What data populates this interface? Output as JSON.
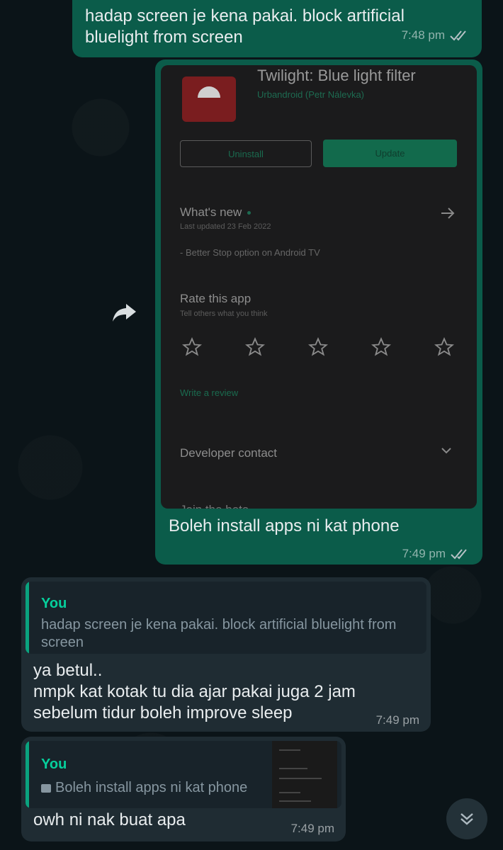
{
  "messages": [
    {
      "id": "m1",
      "text": "hadap screen je kena pakai. block artificial bluelight from screen",
      "time": "7:48 pm",
      "status": "read"
    },
    {
      "id": "m2",
      "caption": "Boleh install apps ni kat phone",
      "time": "7:49 pm",
      "status": "read",
      "screenshot": {
        "app_title": "Twilight: Blue light filter",
        "developer": "Urbandroid (Petr Nálevka)",
        "uninstall_label": "Uninstall",
        "update_label": "Update",
        "whats_new_title": "What's new",
        "last_updated": "Last updated 23 Feb 2022",
        "update_note": "- Better Stop option on Android TV",
        "rate_title": "Rate this app",
        "rate_sub": "Tell others what you think",
        "write_review": "Write a review",
        "developer_contact": "Developer contact",
        "cut_text": "Join the beta"
      }
    },
    {
      "id": "m3",
      "quote_author": "You",
      "quote_text": "hadap screen je kena pakai. block artificial bluelight from screen",
      "text_lines": [
        "ya betul..",
        "nmpk kat kotak tu dia ajar pakai juga 2 jam",
        "sebelum tidur boleh improve sleep"
      ],
      "time": "7:49 pm"
    },
    {
      "id": "m4",
      "quote_author": "You",
      "quote_text": "Boleh install apps ni kat phone",
      "text": "owh ni nak buat apa",
      "time": "7:49 pm"
    }
  ],
  "colors": {
    "background": "#0b1418",
    "outgoing_bubble": "#0b5c4a",
    "incoming_bubble": "#1f2c33",
    "quote_accent": "#06cf9c",
    "read_ticks": "#8696a0"
  },
  "icons": [
    "forward-icon",
    "double-check-icon",
    "star-icon",
    "arrow-right-icon",
    "chevron-down-icon",
    "image-icon",
    "scroll-down-icon"
  ]
}
